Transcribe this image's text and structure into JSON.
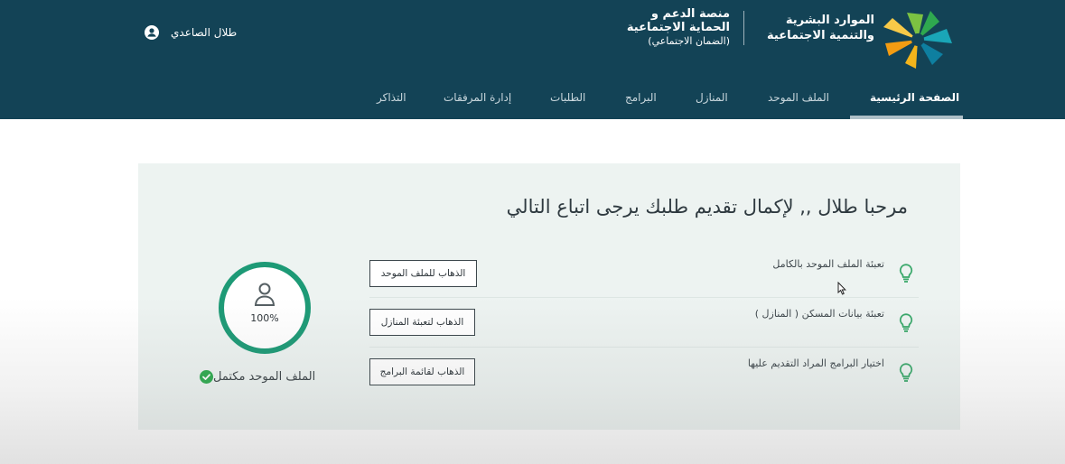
{
  "header": {
    "user_name": "طلال الصاعدي",
    "platform_line1": "منصة الدعم و",
    "platform_line2": "الحماية الاجتماعية",
    "platform_line3": "(الضمان الاجتماعي)",
    "ministry_line1": "الموارد البشرية",
    "ministry_line2": "والتنمية الاجتماعية",
    "colors": {
      "background": "#134356",
      "logo_green": "#4caf50",
      "logo_orange": "#f39c12",
      "logo_teal": "#1aa6b7"
    }
  },
  "nav": {
    "items": [
      {
        "label": "الصفحة الرئيسية",
        "active": true
      },
      {
        "label": "الملف الموحد",
        "active": false
      },
      {
        "label": "المنازل",
        "active": false
      },
      {
        "label": "البرامج",
        "active": false
      },
      {
        "label": "الطلبات",
        "active": false
      },
      {
        "label": "إدارة المرفقات",
        "active": false
      },
      {
        "label": "التذاكر",
        "active": false
      }
    ]
  },
  "main": {
    "welcome": "مرحبا طلال ,, لإكمال تقديم طلبك يرجى اتباع التالي",
    "steps": [
      {
        "label": "تعبئة الملف الموحد بالكامل",
        "button": "الذهاب للملف الموحد",
        "icon": "lightbulb-icon"
      },
      {
        "label": "تعبئة بيانات المسكن ( المنازل )",
        "button": "الذهاب لتعبئة المنازل",
        "icon": "lightbulb-icon"
      },
      {
        "label": "اختيار البرامج المراد التقديم عليها",
        "button": "الذهاب لقائمة البرامج",
        "icon": "lightbulb-icon"
      }
    ],
    "profile_progress": {
      "percent_text": "100%",
      "progress": 1.0,
      "status": "الملف الموحد مكتمل",
      "ring_color": "#1d9a76",
      "check_color": "#2eaa4f"
    }
  }
}
